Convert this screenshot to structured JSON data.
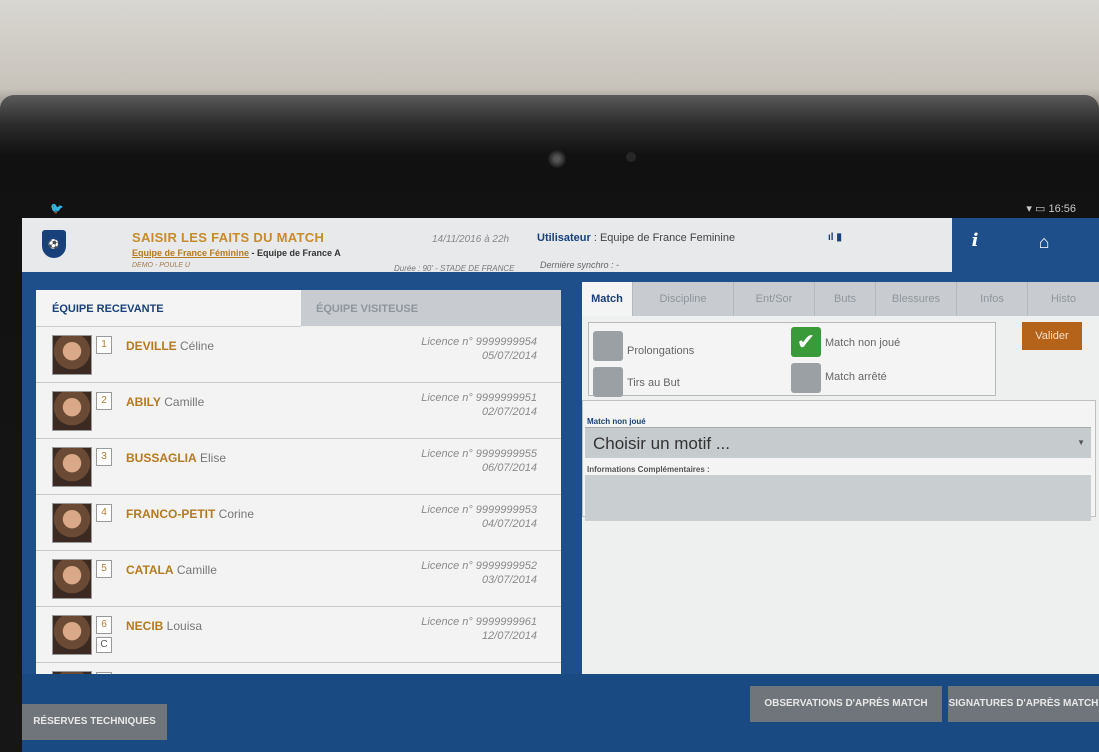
{
  "status": {
    "time": "16:56",
    "left_icon": "twitter-icon"
  },
  "header": {
    "title": "SAISIR LES FAITS DU MATCH",
    "subtitle_teams": "Equipe de France Féminine",
    "subtitle_sep": " - Equipe de France A",
    "competition": "DEMO - POULE U",
    "date": "14/11/2016 à 22h",
    "duree": "Durée : 90' - STADE DE FRANCE",
    "user_label": "Utilisateur",
    "user_value": " : Equipe de France Feminine",
    "sync": "Dernière synchro : -",
    "info_button": "i"
  },
  "teams": {
    "home": "ÉQUIPE RECEVANTE",
    "away": "ÉQUIPE VISITEUSE"
  },
  "players": [
    {
      "num": "1",
      "last": "DEVILLE",
      "first": " Céline",
      "licence": "Licence n° 9999999954",
      "date": "05/07/2014",
      "captain": ""
    },
    {
      "num": "2",
      "last": "ABILY",
      "first": " Camille",
      "licence": "Licence n° 9999999951",
      "date": "02/07/2014",
      "captain": ""
    },
    {
      "num": "3",
      "last": "BUSSAGLIA",
      "first": " Elise",
      "licence": "Licence n° 9999999955",
      "date": "06/07/2014",
      "captain": ""
    },
    {
      "num": "4",
      "last": "FRANCO-PETIT",
      "first": " Corine",
      "licence": "Licence n° 9999999953",
      "date": "04/07/2014",
      "captain": ""
    },
    {
      "num": "5",
      "last": "CATALA",
      "first": " Camille",
      "licence": "Licence n° 9999999952",
      "date": "03/07/2014",
      "captain": ""
    },
    {
      "num": "6",
      "last": "NECIB",
      "first": " Louisa",
      "licence": "Licence n° 9999999961",
      "date": "12/07/2014",
      "captain": "C"
    }
  ],
  "match_tabs": [
    "Match",
    "Discipline",
    "Ent/Sor",
    "Buts",
    "Blessures",
    "Infos",
    "Histo"
  ],
  "options": {
    "prolongations": "Prolongations",
    "tirs": "Tirs au But",
    "non_joue": "Match non joué",
    "arrete": "Match arrêté",
    "non_joue_checked": true
  },
  "valider": "Valider",
  "mnj": {
    "label": "Match non joué",
    "select_value": "Choisir un motif ...",
    "info_label": "Informations Complémentaires :"
  },
  "bottom": {
    "reserves": "RÉSERVES TECHNIQUES",
    "observations": "OBSERVATIONS D'APRÈS MATCH",
    "signatures": "SIGNATURES D'APRÈS MATCH"
  }
}
